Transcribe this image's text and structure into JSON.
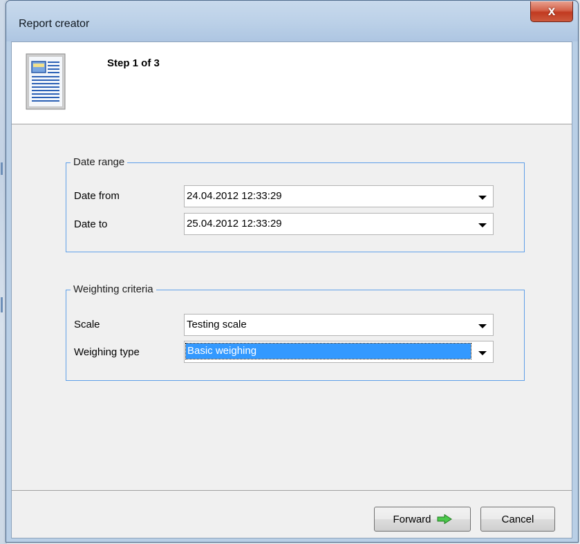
{
  "window": {
    "title": "Report creator",
    "close_glyph": "x"
  },
  "header": {
    "step": "Step 1 of 3",
    "icon": "report-document-icon"
  },
  "date_range": {
    "legend": "Date range",
    "date_from": {
      "label": "Date from",
      "value": "24.04.2012 12:33:29"
    },
    "date_to": {
      "label": "Date to",
      "value": "25.04.2012 12:33:29"
    }
  },
  "weighting": {
    "legend": "Weighting criteria",
    "scale": {
      "label": "Scale",
      "value": "Testing scale"
    },
    "weighing_type": {
      "label": "Weighing type",
      "value": "Basic weighing"
    }
  },
  "buttons": {
    "forward": "Forward",
    "cancel": "Cancel"
  },
  "colors": {
    "group_border": "#5d9ee8",
    "selection": "#3399ff",
    "forward_arrow": "#3cb43c"
  }
}
